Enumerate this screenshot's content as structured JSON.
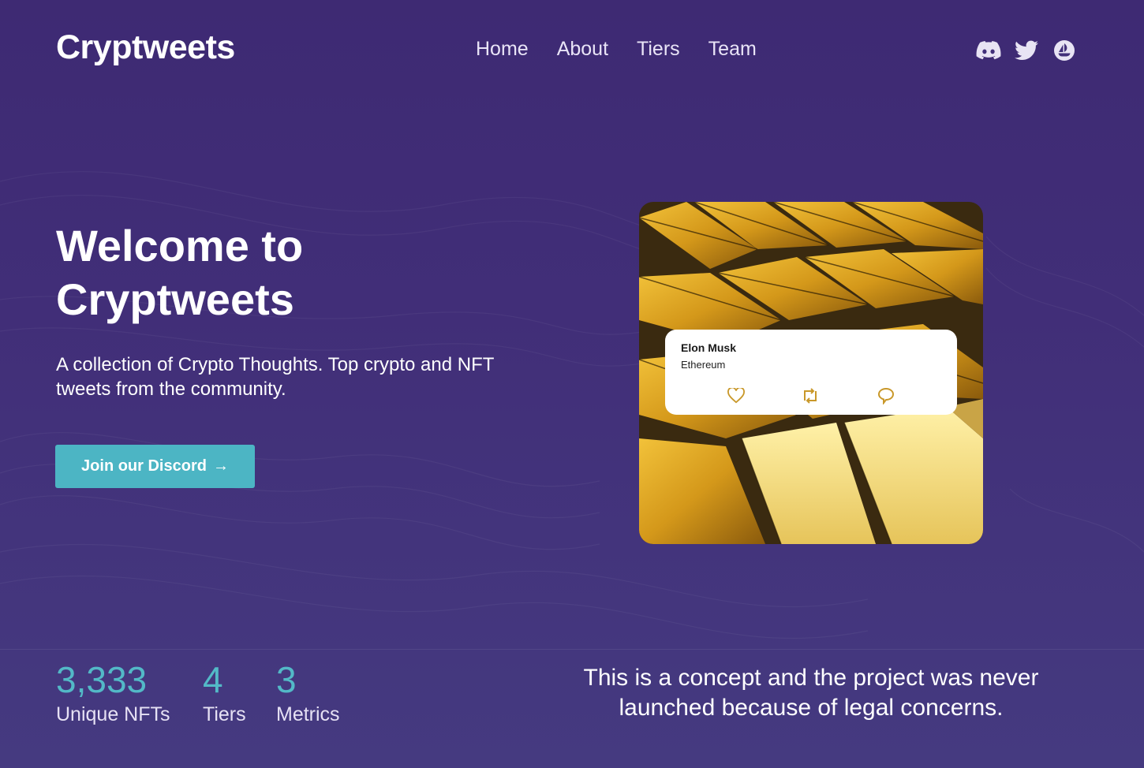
{
  "brand": {
    "logo": "Cryptweets"
  },
  "nav": {
    "items": [
      "Home",
      "About",
      "Tiers",
      "Team"
    ]
  },
  "socials": [
    {
      "icon": "discord-icon"
    },
    {
      "icon": "twitter-icon"
    },
    {
      "icon": "opensea-icon"
    }
  ],
  "hero": {
    "title_line1": "Welcome to",
    "title_line2": "Cryptweets",
    "subtitle": "A collection of Crypto Thoughts. Top crypto and NFT tweets from the community.",
    "cta_label": "Join our Discord",
    "cta_arrow": "→"
  },
  "tweet_card": {
    "author": "Elon Musk",
    "handle": "Ethereum",
    "actions": [
      "heart-icon",
      "retweet-icon",
      "comment-icon"
    ]
  },
  "stats": [
    {
      "value": "3,333",
      "label": "Unique NFTs"
    },
    {
      "value": "4",
      "label": "Tiers"
    },
    {
      "value": "3",
      "label": "Metrics"
    }
  ],
  "notice": "This is a concept and the project was never launched because of legal concerns.",
  "colors": {
    "background": "#412e78",
    "accent": "#4cb5c4",
    "stat_value": "#53b9c7",
    "gold": "#d9a520"
  }
}
